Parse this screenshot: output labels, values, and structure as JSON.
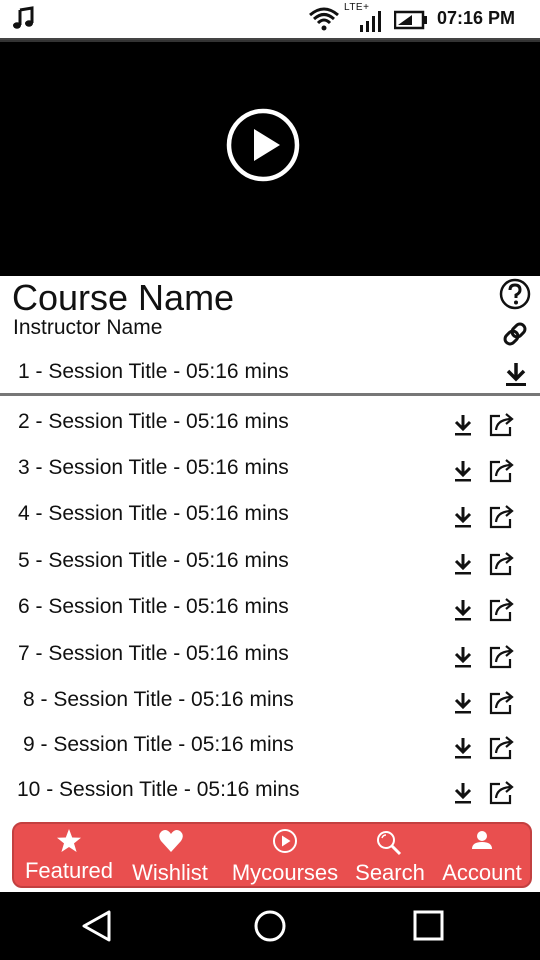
{
  "status_bar": {
    "network_label": "LTE+",
    "time": "07:16 PM",
    "icons": [
      "music-icon",
      "wifi-icon",
      "signal-icon",
      "battery-icon"
    ]
  },
  "player": {
    "play_icon": "play-circle-icon"
  },
  "course": {
    "title": "Course Name",
    "instructor": "Instructor Name",
    "help_icon": "question-circle-icon",
    "link_icon": "link-icon"
  },
  "current_session": {
    "label": "1 - Session Title - 05:16 mins",
    "download_icon": "download-icon"
  },
  "sessions": [
    {
      "label": "2 - Session Title - 05:16 mins"
    },
    {
      "label": "3 - Session Title - 05:16 mins"
    },
    {
      "label": "4 - Session Title - 05:16 mins"
    },
    {
      "label": "5 - Session Title - 05:16 mins"
    },
    {
      "label": "6 - Session Title - 05:16 mins"
    },
    {
      "label": "7 - Session Title - 05:16 mins"
    },
    {
      "label": "8 - Session Title - 05:16 mins"
    },
    {
      "label": "9 - Session Title - 05:16 mins"
    },
    {
      "label": "10 - Session Title - 05:16 mins"
    }
  ],
  "tabs": [
    {
      "label": "Featured",
      "icon": "star-icon"
    },
    {
      "label": "Wishlist",
      "icon": "heart-icon"
    },
    {
      "label": "Mycourses",
      "icon": "play-circle-icon"
    },
    {
      "label": "Search",
      "icon": "search-icon"
    },
    {
      "label": "Account",
      "icon": "user-icon"
    }
  ],
  "colors": {
    "tab_bar": "#e94f4f",
    "video_background": "#000000",
    "nav_bar": "#000000"
  },
  "nav_bar": {
    "buttons": [
      "back-icon",
      "home-icon",
      "recents-icon"
    ]
  }
}
